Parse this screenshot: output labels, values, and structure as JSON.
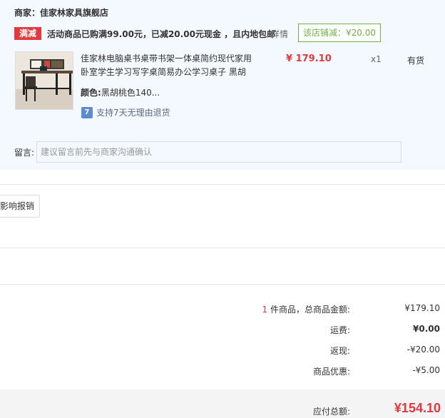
{
  "shop": {
    "seller": "商家：佳家林家具旗舰店",
    "promo_tag": "满减",
    "promo_text": "活动商品已购满99.00元，已减20.00元现金 ，且内地包邮",
    "promo_detail": "详情",
    "shop_reduce": "该店铺减：¥20.00"
  },
  "item": {
    "title": "佳家林电脑桌书桌带书架一体桌简约现代家用卧室学生学习写字桌简易办公学习桌子 黑胡",
    "price": "¥ 179.10",
    "qty": "x1",
    "stock": "有货",
    "attr_label": "颜色:",
    "attr_value": "黑胡桃色140...",
    "return_icon": "7",
    "return_text": "支持7天无理由退货"
  },
  "remark": {
    "label": "留言:",
    "placeholder": "建议留言前先与商家沟通确认"
  },
  "invoice_button": "影响报销",
  "summary": {
    "count": "1",
    "count_suffix": " 件商品，总商品金额:",
    "goods_total": "¥179.10",
    "shipping_label": "运费:",
    "shipping_value": "¥0.00",
    "cashback_label": "返现:",
    "cashback_value": "-¥20.00",
    "discount_label": "商品优惠:",
    "discount_value": "-¥5.00"
  },
  "total": {
    "label": "应付总额:",
    "value": "¥154.10"
  },
  "colors": {
    "accent_red": "#e4393c",
    "shop_bg": "#f3f9ff",
    "reduce_green": "#71b247",
    "return_blue": "#5d8cce"
  }
}
